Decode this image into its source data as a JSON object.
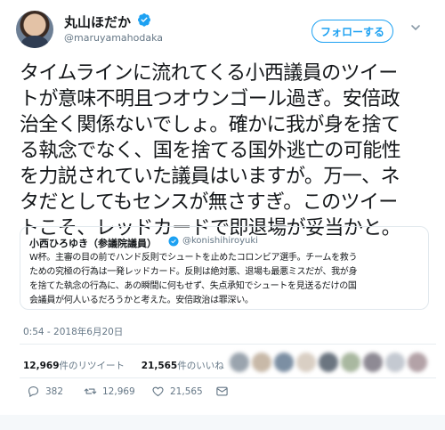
{
  "author": {
    "name": "丸山ほだか",
    "handle": "@maruyamahodaka",
    "follow_label": "フォローする"
  },
  "tweet": {
    "lines": [
      "タイムラインに流れてくる小西議員のツイー",
      "トが意味不明且つオウンゴール過ぎ。安倍政",
      "治全く関係ないでしょ。確かに我が身を捨て",
      "る執念でなく、国を捨てる国外逃亡の可能性",
      "を力説されていた議員はいますが。万一、ネ",
      "タだとしてもセンスが無さすぎ。このツイー",
      "トこそ、レッドカードで即退場が妥当かと。"
    ]
  },
  "quote": {
    "name": "小西ひろゆき（参議院議員）",
    "handle": "@konishihiroyuki",
    "lines": [
      "W杯。主審の目の前でハンド反則でシュートを止めたコロンビア選手。チームを救う",
      "ための究極の行為は一発レッドカード。反則は絶対悪、退場も最悪ミスだが、我が身",
      "を捨てた執念の行為に、あの瞬間に何もせず、失点承知でシュートを見送るだけの国",
      "会議員が何人いるだろうかと考えた。安倍政治は罪深い。"
    ]
  },
  "timestamp": "0:54 - 2018年6月20日",
  "stats": {
    "retweets_count": "12,969",
    "retweets_label": "件のリツイート",
    "likes_count": "21,565",
    "likes_label": "件のいいね"
  },
  "actions": {
    "replies": "382",
    "retweets": "12,969",
    "likes": "21,565"
  },
  "colors": {
    "accent": "#1da1f2",
    "muted": "#657786",
    "retweet": "#17bf63"
  },
  "icons": [
    "verified-badge-icon",
    "chevron-down-icon",
    "reply-icon",
    "retweet-icon",
    "like-icon",
    "message-icon"
  ]
}
